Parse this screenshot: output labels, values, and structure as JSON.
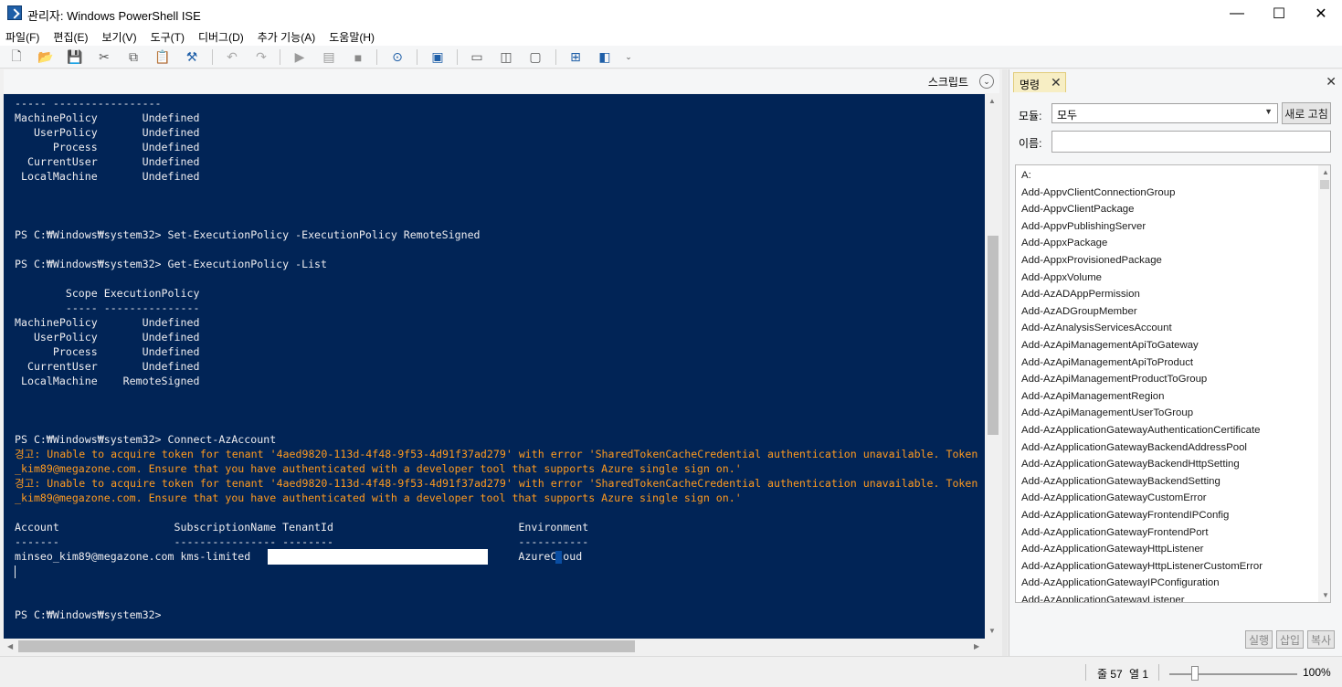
{
  "window": {
    "title": "관리자: Windows PowerShell ISE",
    "minimize": "—",
    "maximize": "☐",
    "close": "✕"
  },
  "menu": [
    "파일(F)",
    "편집(E)",
    "보기(V)",
    "도구(T)",
    "디버그(D)",
    "추가 기능(A)",
    "도움말(H)"
  ],
  "script_bar": {
    "label": "스크립트",
    "toggle": "⌄"
  },
  "console": {
    "lines": [
      {
        "text": "----- -----------------",
        "warn": false
      },
      {
        "text": "MachinePolicy       Undefined",
        "warn": false
      },
      {
        "text": "   UserPolicy       Undefined",
        "warn": false
      },
      {
        "text": "      Process       Undefined",
        "warn": false
      },
      {
        "text": "  CurrentUser       Undefined",
        "warn": false
      },
      {
        "text": " LocalMachine       Undefined",
        "warn": false
      },
      {
        "text": "",
        "warn": false
      },
      {
        "text": "",
        "warn": false
      },
      {
        "text": "",
        "warn": false
      },
      {
        "text": "PS C:₩Windows₩system32> Set-ExecutionPolicy -ExecutionPolicy RemoteSigned",
        "warn": false
      },
      {
        "text": "",
        "warn": false
      },
      {
        "text": "PS C:₩Windows₩system32> Get-ExecutionPolicy -List",
        "warn": false
      },
      {
        "text": "",
        "warn": false
      },
      {
        "text": "        Scope ExecutionPolicy",
        "warn": false
      },
      {
        "text": "        ----- ---------------",
        "warn": false
      },
      {
        "text": "MachinePolicy       Undefined",
        "warn": false
      },
      {
        "text": "   UserPolicy       Undefined",
        "warn": false
      },
      {
        "text": "      Process       Undefined",
        "warn": false
      },
      {
        "text": "  CurrentUser       Undefined",
        "warn": false
      },
      {
        "text": " LocalMachine    RemoteSigned",
        "warn": false
      },
      {
        "text": "",
        "warn": false
      },
      {
        "text": "",
        "warn": false
      },
      {
        "text": "",
        "warn": false
      },
      {
        "text": "PS C:₩Windows₩system32> Connect-AzAccount",
        "warn": false
      },
      {
        "text": "경고: Unable to acquire token for tenant '4aed9820-113d-4f48-9f53-4d91f37ad279' with error 'SharedTokenCacheCredential authentication unavailable. Token acquisitio",
        "warn": true
      },
      {
        "text": "_kim89@megazone.com. Ensure that you have authenticated with a developer tool that supports Azure single sign on.'",
        "warn": true
      },
      {
        "text": "경고: Unable to acquire token for tenant '4aed9820-113d-4f48-9f53-4d91f37ad279' with error 'SharedTokenCacheCredential authentication unavailable. Token acquisitio",
        "warn": true
      },
      {
        "text": "_kim89@megazone.com. Ensure that you have authenticated with a developer tool that supports Azure single sign on.'",
        "warn": true
      },
      {
        "text": "",
        "warn": false
      },
      {
        "text": "Account                  SubscriptionName TenantId                             Environment",
        "warn": false
      },
      {
        "text": "-------                  ---------------- --------                             -----------",
        "warn": false
      },
      {
        "text": "minseo_kim89@megazone.com kms-limited                                          AzureCloud",
        "warn": false
      },
      {
        "text": "",
        "warn": false
      },
      {
        "text": "",
        "warn": false
      },
      {
        "text": "",
        "warn": false
      },
      {
        "text": "PS C:₩Windows₩system32>",
        "warn": false
      }
    ]
  },
  "commands_panel": {
    "tab_label": "명령",
    "tab_close": "✕",
    "panel_close": "✕",
    "module_label": "모듈:",
    "module_value": "모두",
    "refresh_button": "새로 고침",
    "name_label": "이름:",
    "name_value": "",
    "commands": [
      "A:",
      "Add-AppvClientConnectionGroup",
      "Add-AppvClientPackage",
      "Add-AppvPublishingServer",
      "Add-AppxPackage",
      "Add-AppxProvisionedPackage",
      "Add-AppxVolume",
      "Add-AzADAppPermission",
      "Add-AzADGroupMember",
      "Add-AzAnalysisServicesAccount",
      "Add-AzApiManagementApiToGateway",
      "Add-AzApiManagementApiToProduct",
      "Add-AzApiManagementProductToGroup",
      "Add-AzApiManagementRegion",
      "Add-AzApiManagementUserToGroup",
      "Add-AzApplicationGatewayAuthenticationCertificate",
      "Add-AzApplicationGatewayBackendAddressPool",
      "Add-AzApplicationGatewayBackendHttpSetting",
      "Add-AzApplicationGatewayBackendSetting",
      "Add-AzApplicationGatewayCustomError",
      "Add-AzApplicationGatewayFrontendIPConfig",
      "Add-AzApplicationGatewayFrontendPort",
      "Add-AzApplicationGatewayHttpListener",
      "Add-AzApplicationGatewayHttpListenerCustomError",
      "Add-AzApplicationGatewayIPConfiguration",
      "Add-AzApplicationGatewayListener"
    ],
    "run_button": "실행",
    "insert_button": "삽입",
    "copy_button": "복사"
  },
  "status": {
    "line": "줄 57",
    "col": "열 1",
    "zoom": "100%"
  },
  "colors": {
    "console_bg": "#012456",
    "console_text": "#eeedf0",
    "warning_text": "#ff9a1f"
  }
}
